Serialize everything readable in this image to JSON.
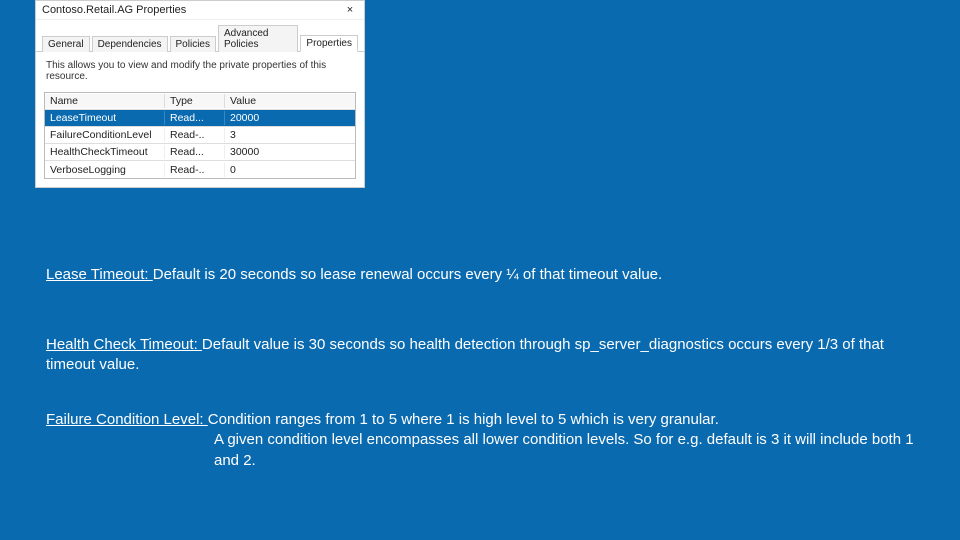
{
  "dialog": {
    "title": "Contoso.Retail.AG Properties",
    "close": "×",
    "tabs": {
      "t0": "General",
      "t1": "Dependencies",
      "t2": "Policies",
      "t3": "Advanced Policies",
      "t4": "Properties"
    },
    "description": "This allows you to view and modify the private properties of this resource.",
    "columns": {
      "c0": "Name",
      "c1": "Type",
      "c2": "Value"
    },
    "rows": {
      "r0": {
        "name": "LeaseTimeout",
        "type": "Read...",
        "value": "20000"
      },
      "r1": {
        "name": "FailureConditionLevel",
        "type": "Read-..",
        "value": "3"
      },
      "r2": {
        "name": "HealthCheckTimeout",
        "type": "Read...",
        "value": "30000"
      },
      "r3": {
        "name": "VerboseLogging",
        "type": "Read-..",
        "value": "0"
      }
    }
  },
  "explain": {
    "lease_label": "Lease Timeout: ",
    "lease_text": "Default is 20 seconds so lease renewal occurs every ¼ of that timeout value.",
    "health_label": "Health Check Timeout: ",
    "health_text": "Default value is 30 seconds so health detection through sp_server_diagnostics occurs every 1/3 of that timeout value.",
    "fcl_label": "Failure Condition Level: ",
    "fcl_text1": "Condition ranges from 1 to 5 where 1 is high level to 5 which is very granular.",
    "fcl_text2": "A given condition level encompasses all lower condition levels. So for e.g. default is 3 it will include both 1 and 2."
  }
}
